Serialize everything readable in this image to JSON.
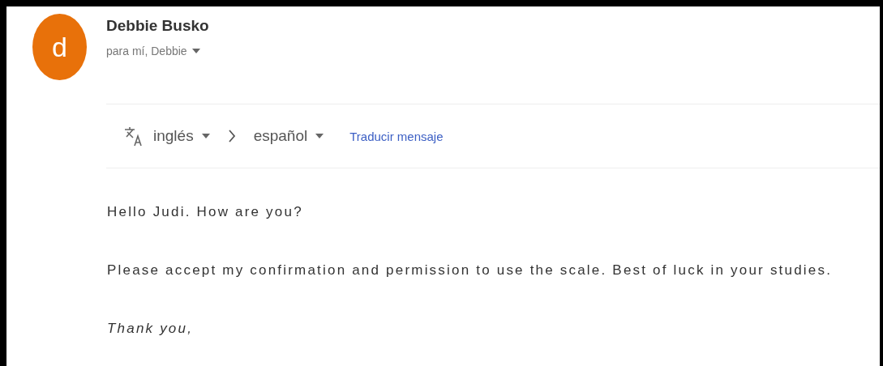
{
  "sender": {
    "avatar_letter": "d",
    "name": "Debbie Busko",
    "recipients": "para mí, Debbie"
  },
  "translate_bar": {
    "source_language": "inglés",
    "target_language": "español",
    "action": "Traducir mensaje"
  },
  "body": [
    {
      "text": "Hello Judi. How are you?",
      "italic": false
    },
    {
      "text": "Please accept my confirmation and permission to use the scale. Best of luck in your studies.",
      "italic": false
    },
    {
      "text": "Thank you,",
      "italic": true
    }
  ]
}
